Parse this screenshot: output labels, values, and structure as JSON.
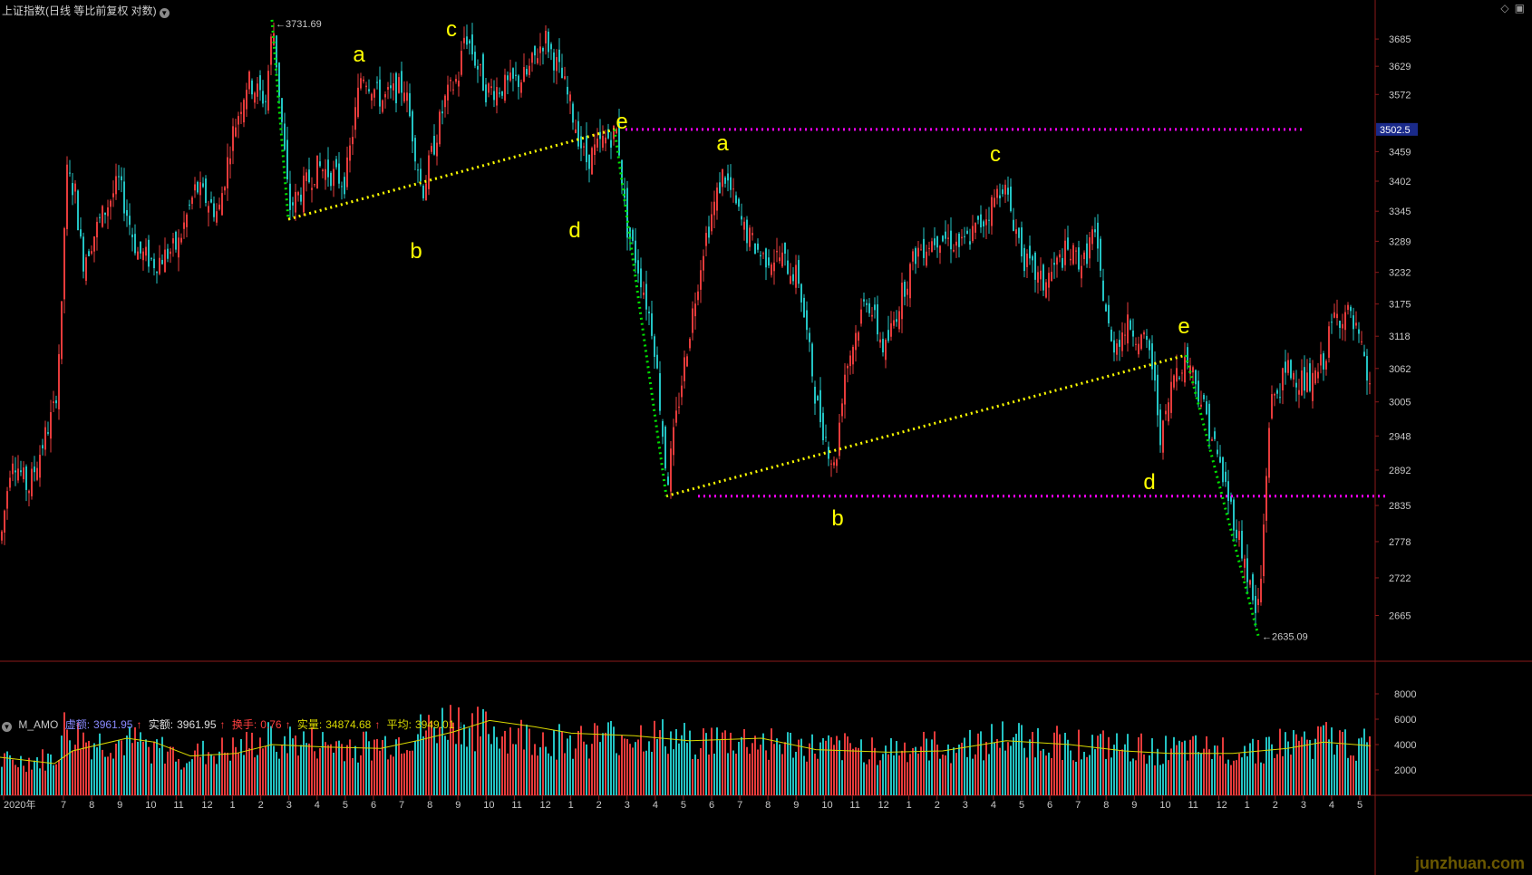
{
  "header": {
    "title": "上证指数(日线 等比前复权 对数)",
    "menu_icon": "chevron-down-icon",
    "right_icons": [
      "diamond-icon",
      "window-toggle-icon"
    ]
  },
  "colors": {
    "up": "#e63b3b",
    "down": "#23c3c3",
    "axis": "#8b1a1a",
    "wave_text": "#ffff00",
    "trend": "#ffff00",
    "impulse": "#00e000",
    "level": "#ff00ff",
    "ma": "#d8d800",
    "price_tag_bg": "#1a2a8a"
  },
  "indicator": {
    "name": "M_AMO",
    "xuer_label": "虚额:",
    "xuer_value": "3961.95",
    "shie_label": "实额:",
    "shie_value": "3961.95",
    "huanshou_label": "换手:",
    "huanshou_value": "0.76",
    "shiliang_label": "实量:",
    "shiliang_value": "34874.68",
    "pingjun_label": "平均:",
    "pingjun_value": "3949.01"
  },
  "watermark": "junzhuan.com",
  "chart_data": {
    "type": "candlestick",
    "scale": "log",
    "ylim": [
      2600,
      3740
    ],
    "yticks": [
      "3685",
      "3629",
      "3572",
      "3459",
      "3402",
      "3345",
      "3289",
      "3232",
      "3175",
      "3118",
      "3062",
      "3005",
      "2948",
      "2892",
      "2835",
      "2778",
      "2722",
      "2665"
    ],
    "price_tag": "3502.5",
    "high_label": "3731.69",
    "low_label": "2635.09",
    "xticks": [
      "2020年",
      "7",
      "8",
      "9",
      "10",
      "11",
      "12",
      "1",
      "2",
      "3",
      "4",
      "5",
      "6",
      "7",
      "8",
      "9",
      "10",
      "11",
      "12",
      "1",
      "2",
      "3",
      "4",
      "5",
      "6",
      "7",
      "8",
      "9",
      "10",
      "11",
      "12",
      "1",
      "2",
      "3",
      "4",
      "5",
      "6",
      "7",
      "8",
      "9",
      "10",
      "11",
      "12",
      "1",
      "2",
      "3",
      "4",
      "5"
    ],
    "close_path": [
      [
        0,
        2780
      ],
      [
        12,
        2920
      ],
      [
        30,
        2860
      ],
      [
        60,
        3000
      ],
      [
        67,
        3160
      ],
      [
        72,
        3420
      ],
      [
        82,
        3380
      ],
      [
        90,
        3250
      ],
      [
        110,
        3330
      ],
      [
        130,
        3400
      ],
      [
        150,
        3270
      ],
      [
        170,
        3250
      ],
      [
        195,
        3280
      ],
      [
        215,
        3390
      ],
      [
        240,
        3340
      ],
      [
        255,
        3490
      ],
      [
        272,
        3600
      ],
      [
        292,
        3560
      ],
      [
        300,
        3720
      ],
      [
        318,
        3350
      ],
      [
        350,
        3430
      ],
      [
        380,
        3400
      ],
      [
        398,
        3620
      ],
      [
        420,
        3560
      ],
      [
        445,
        3590
      ],
      [
        465,
        3380
      ],
      [
        490,
        3560
      ],
      [
        505,
        3610
      ],
      [
        512,
        3700
      ],
      [
        535,
        3580
      ],
      [
        560,
        3590
      ],
      [
        580,
        3610
      ],
      [
        600,
        3690
      ],
      [
        620,
        3600
      ],
      [
        645,
        3440
      ],
      [
        665,
        3480
      ],
      [
        680,
        3500
      ],
      [
        690,
        3320
      ],
      [
        705,
        3230
      ],
      [
        720,
        3120
      ],
      [
        735,
        2870
      ],
      [
        750,
        3030
      ],
      [
        775,
        3280
      ],
      [
        797,
        3420
      ],
      [
        820,
        3310
      ],
      [
        840,
        3260
      ],
      [
        860,
        3260
      ],
      [
        880,
        3220
      ],
      [
        900,
        3000
      ],
      [
        920,
        2890
      ],
      [
        930,
        3050
      ],
      [
        955,
        3190
      ],
      [
        975,
        3090
      ],
      [
        995,
        3200
      ],
      [
        1010,
        3270
      ],
      [
        1035,
        3300
      ],
      [
        1060,
        3280
      ],
      [
        1085,
        3330
      ],
      [
        1105,
        3400
      ],
      [
        1130,
        3250
      ],
      [
        1150,
        3210
      ],
      [
        1175,
        3270
      ],
      [
        1195,
        3250
      ],
      [
        1205,
        3310
      ],
      [
        1225,
        3100
      ],
      [
        1245,
        3140
      ],
      [
        1268,
        3090
      ],
      [
        1280,
        2940
      ],
      [
        1295,
        3060
      ],
      [
        1310,
        3080
      ],
      [
        1330,
        2980
      ],
      [
        1350,
        2870
      ],
      [
        1370,
        2760
      ],
      [
        1385,
        2660
      ],
      [
        1390,
        2720
      ],
      [
        1400,
        3000
      ],
      [
        1420,
        3060
      ],
      [
        1445,
        3030
      ],
      [
        1460,
        3080
      ],
      [
        1470,
        3150
      ],
      [
        1485,
        3160
      ],
      [
        1498,
        3110
      ],
      [
        1512,
        3010
      ]
    ],
    "volume": {
      "yticks": [
        "8000",
        "6000",
        "4000",
        "2000"
      ],
      "ylim": [
        0,
        9500
      ],
      "ma_path": [
        [
          0,
          3000
        ],
        [
          60,
          2500
        ],
        [
          80,
          3500
        ],
        [
          140,
          4500
        ],
        [
          170,
          4200
        ],
        [
          210,
          3100
        ],
        [
          260,
          3300
        ],
        [
          300,
          4000
        ],
        [
          360,
          3800
        ],
        [
          420,
          3700
        ],
        [
          460,
          4300
        ],
        [
          500,
          5000
        ],
        [
          540,
          5900
        ],
        [
          590,
          5400
        ],
        [
          630,
          4900
        ],
        [
          700,
          4700
        ],
        [
          760,
          4300
        ],
        [
          840,
          4500
        ],
        [
          900,
          3600
        ],
        [
          980,
          3400
        ],
        [
          1040,
          3500
        ],
        [
          1110,
          4300
        ],
        [
          1180,
          4000
        ],
        [
          1240,
          3500
        ],
        [
          1290,
          3300
        ],
        [
          1360,
          3300
        ],
        [
          1420,
          3700
        ],
        [
          1460,
          4200
        ],
        [
          1512,
          3900
        ]
      ],
      "level_path": [
        [
          0,
          3000
        ],
        [
          60,
          3300
        ],
        [
          70,
          6000
        ],
        [
          100,
          4800
        ],
        [
          150,
          4800
        ],
        [
          200,
          3600
        ],
        [
          260,
          4200
        ],
        [
          300,
          5200
        ],
        [
          360,
          4600
        ],
        [
          420,
          4600
        ],
        [
          460,
          5600
        ],
        [
          500,
          7000
        ],
        [
          520,
          6200
        ],
        [
          560,
          5600
        ],
        [
          620,
          5000
        ],
        [
          700,
          5600
        ],
        [
          760,
          5000
        ],
        [
          840,
          5000
        ],
        [
          900,
          4300
        ],
        [
          980,
          4300
        ],
        [
          1050,
          4500
        ],
        [
          1110,
          5300
        ],
        [
          1180,
          4800
        ],
        [
          1240,
          4300
        ],
        [
          1300,
          4100
        ],
        [
          1360,
          4200
        ],
        [
          1420,
          4800
        ],
        [
          1460,
          5200
        ],
        [
          1512,
          4500
        ]
      ]
    },
    "wave_labels": [
      "a",
      "b",
      "c",
      "d",
      "e",
      "a",
      "b",
      "c",
      "d",
      "e"
    ],
    "annotations": {
      "levels": [
        3502.5,
        2850
      ],
      "impulse_lines": [
        [
          [
            300,
            3725
          ],
          [
            318,
            3330
          ]
        ],
        [
          [
            678,
            3502.5
          ],
          [
            735,
            2850
          ]
        ],
        [
          [
            1308,
            3085
          ],
          [
            1388,
            2635
          ]
        ]
      ],
      "trend_lines": [
        [
          [
            318,
            3330
          ],
          [
            678,
            3502.5
          ]
        ],
        [
          [
            735,
            2850
          ],
          [
            1308,
            3085
          ]
        ]
      ]
    }
  }
}
